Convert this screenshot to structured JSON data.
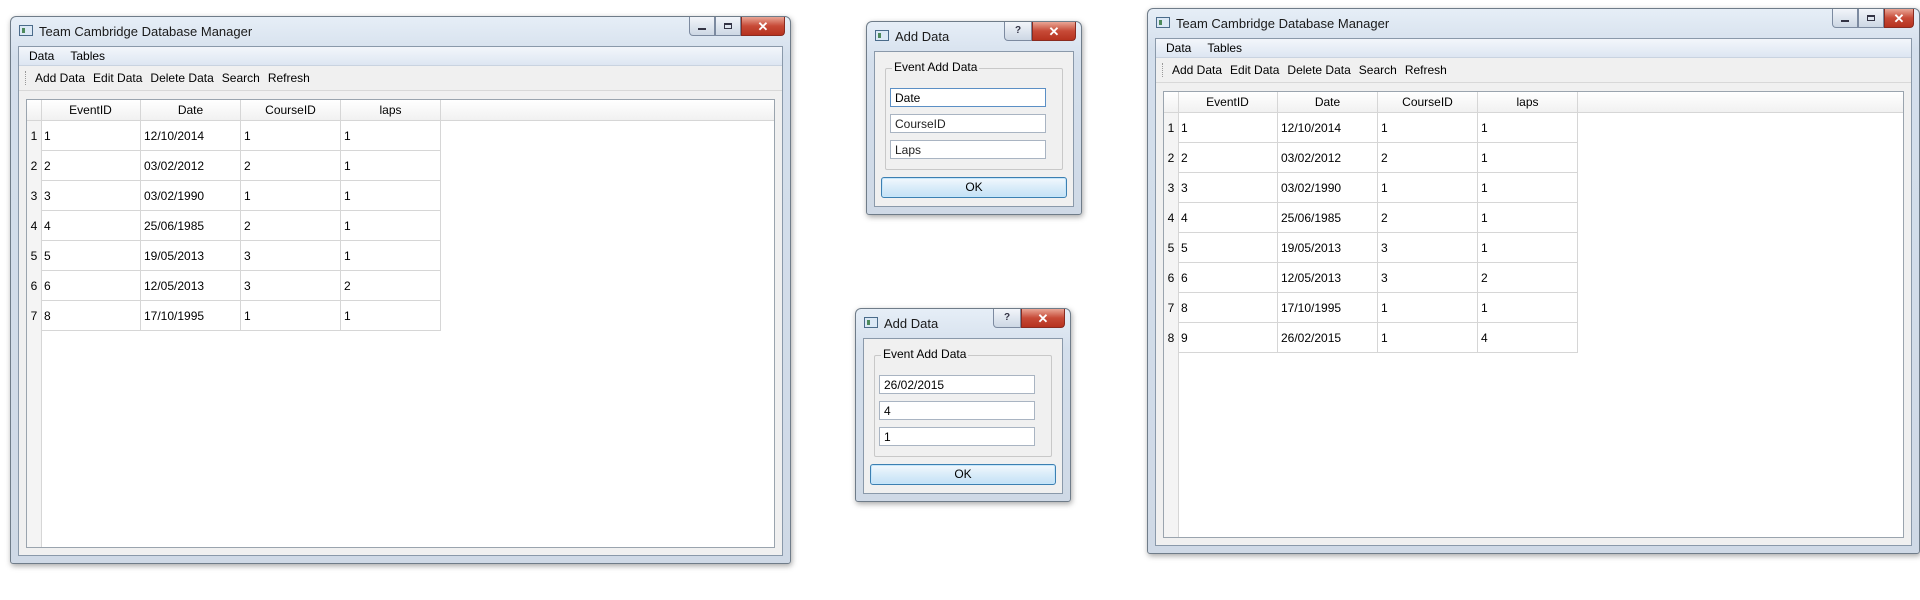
{
  "left_window": {
    "title": "Team Cambridge Database Manager",
    "menu": [
      "Data",
      "Tables"
    ],
    "toolbar": [
      "Add Data",
      "Edit Data",
      "Delete Data",
      "Search",
      "Refresh"
    ],
    "columns": [
      "EventID",
      "Date",
      "CourseID",
      "laps"
    ],
    "rows": [
      {
        "num": "1",
        "cells": [
          "1",
          "12/10/2014",
          "1",
          "1"
        ]
      },
      {
        "num": "2",
        "cells": [
          "2",
          "03/02/2012",
          "2",
          "1"
        ]
      },
      {
        "num": "3",
        "cells": [
          "3",
          "03/02/1990",
          "1",
          "1"
        ]
      },
      {
        "num": "4",
        "cells": [
          "4",
          "25/06/1985",
          "2",
          "1"
        ]
      },
      {
        "num": "5",
        "cells": [
          "5",
          "19/05/2013",
          "3",
          "1"
        ]
      },
      {
        "num": "6",
        "cells": [
          "6",
          "12/05/2013",
          "3",
          "2"
        ]
      },
      {
        "num": "7",
        "cells": [
          "8",
          "17/10/1995",
          "1",
          "1"
        ]
      }
    ]
  },
  "dialog_top": {
    "title": "Add Data",
    "group": "Event Add Data",
    "fields": [
      {
        "value": "Date",
        "placeholder": ""
      },
      {
        "value": "",
        "placeholder": "CourseID"
      },
      {
        "value": "",
        "placeholder": "Laps"
      }
    ],
    "ok": "OK"
  },
  "dialog_bottom": {
    "title": "Add Data",
    "group": "Event Add Data",
    "fields": [
      {
        "value": "26/02/2015"
      },
      {
        "value": "4"
      },
      {
        "value": "1"
      }
    ],
    "ok": "OK"
  },
  "right_window": {
    "title": "Team Cambridge Database Manager",
    "menu": [
      "Data",
      "Tables"
    ],
    "toolbar": [
      "Add Data",
      "Edit Data",
      "Delete Data",
      "Search",
      "Refresh"
    ],
    "columns": [
      "EventID",
      "Date",
      "CourseID",
      "laps"
    ],
    "rows": [
      {
        "num": "1",
        "cells": [
          "1",
          "12/10/2014",
          "1",
          "1"
        ]
      },
      {
        "num": "2",
        "cells": [
          "2",
          "03/02/2012",
          "2",
          "1"
        ]
      },
      {
        "num": "3",
        "cells": [
          "3",
          "03/02/1990",
          "1",
          "1"
        ]
      },
      {
        "num": "4",
        "cells": [
          "4",
          "25/06/1985",
          "2",
          "1"
        ]
      },
      {
        "num": "5",
        "cells": [
          "5",
          "19/05/2013",
          "3",
          "1"
        ]
      },
      {
        "num": "6",
        "cells": [
          "6",
          "12/05/2013",
          "3",
          "2"
        ]
      },
      {
        "num": "7",
        "cells": [
          "8",
          "17/10/1995",
          "1",
          "1"
        ]
      },
      {
        "num": "8",
        "cells": [
          "9",
          "26/02/2015",
          "1",
          "4"
        ]
      }
    ]
  }
}
